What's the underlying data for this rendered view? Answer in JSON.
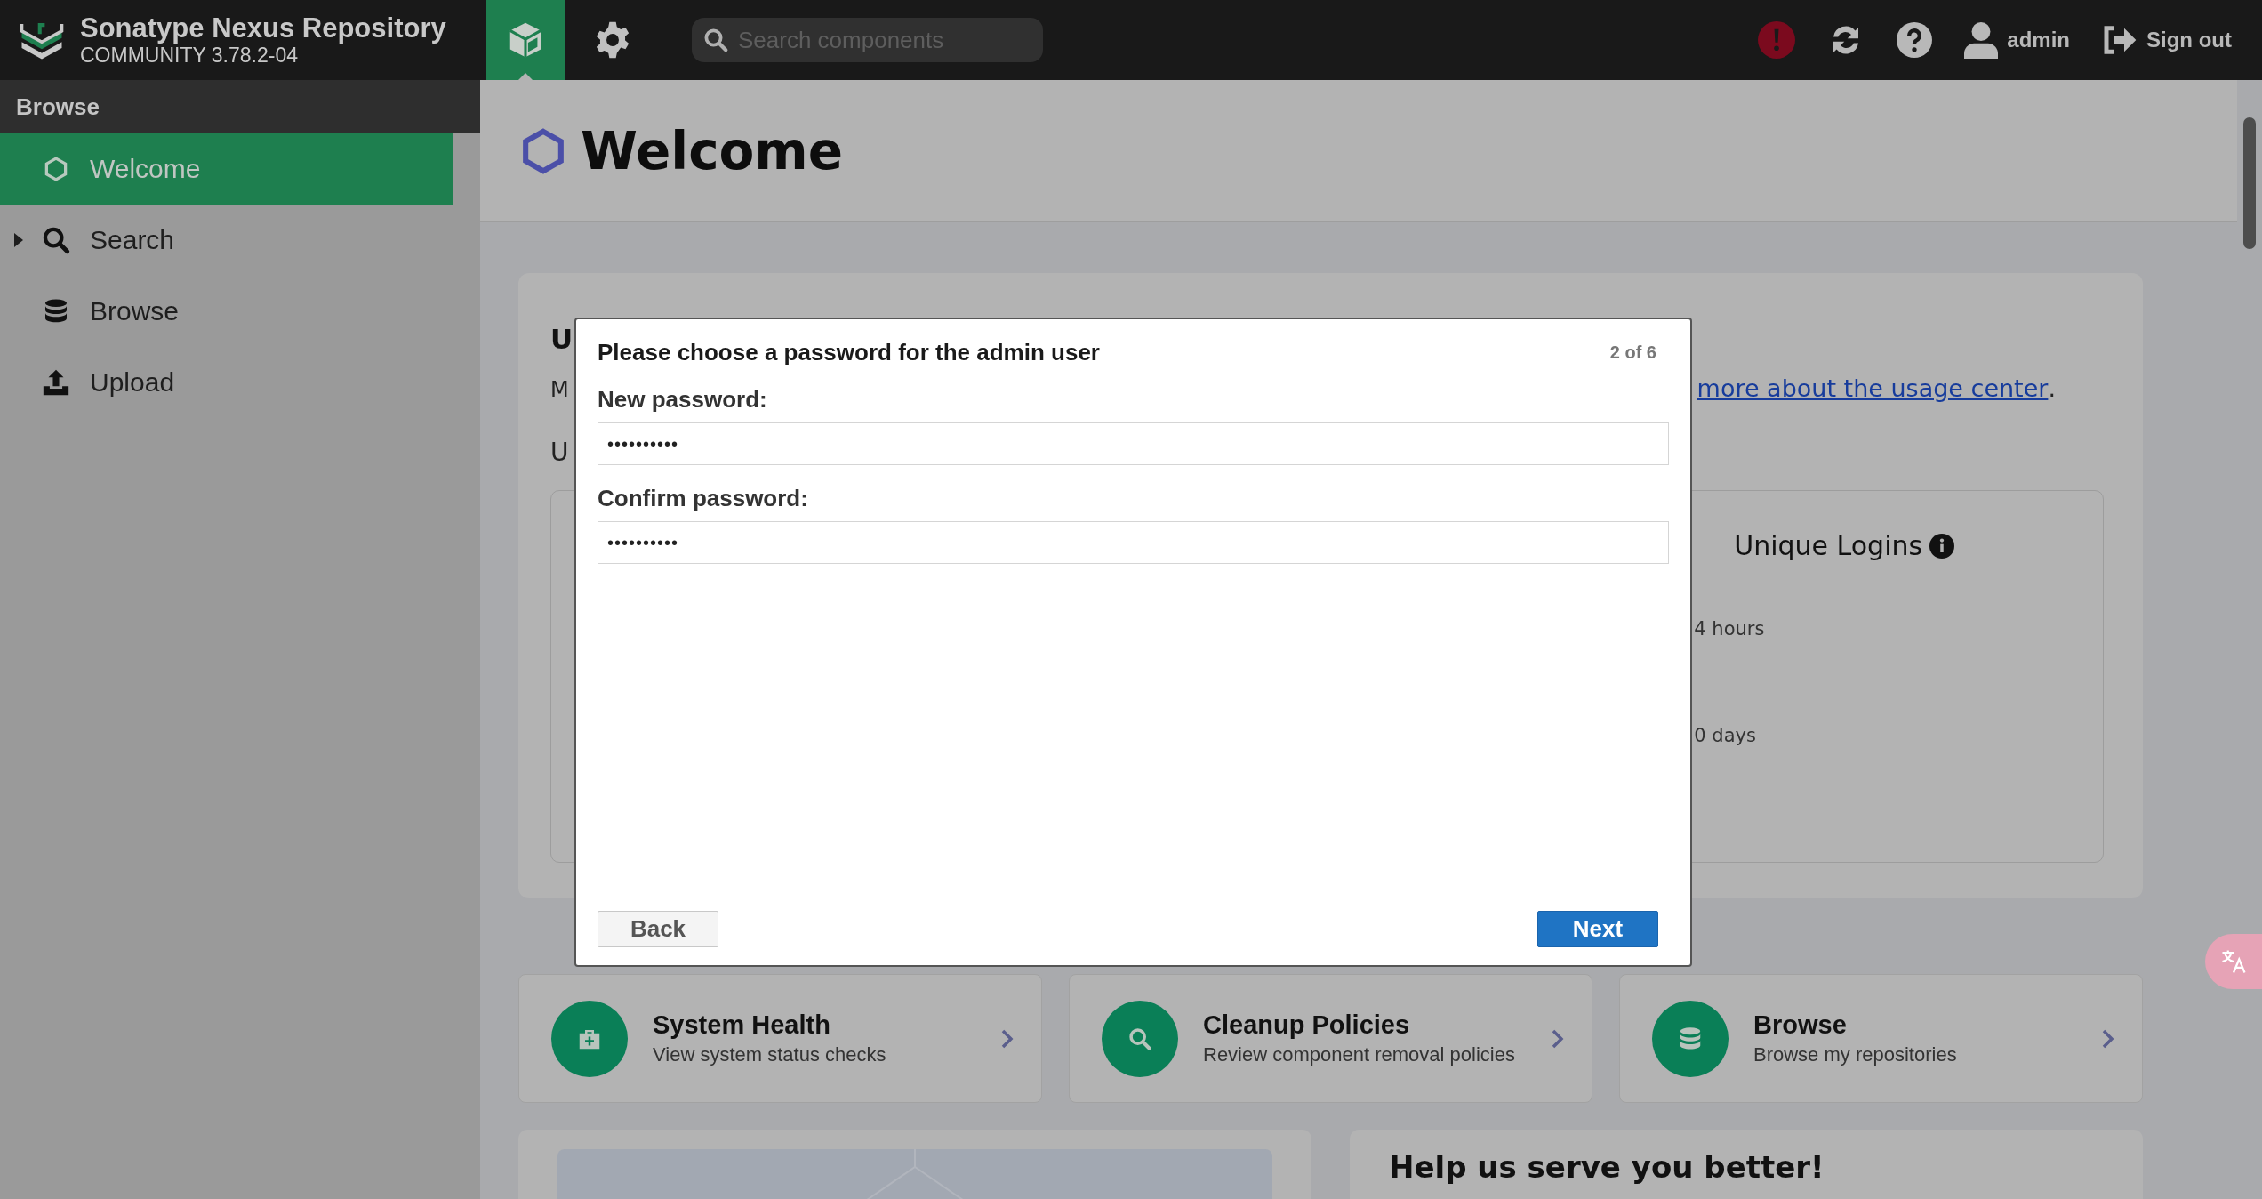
{
  "header": {
    "product_name": "Sonatype Nexus Repository",
    "edition": "COMMUNITY 3.78.2-04",
    "mode_tabs": [
      {
        "kind": "browse",
        "selected": true
      },
      {
        "kind": "admin",
        "selected": false
      }
    ],
    "search": {
      "placeholder": "Search components"
    },
    "user": "admin",
    "sign_out": "Sign out"
  },
  "sidebar": {
    "title": "Browse",
    "items": [
      {
        "label": "Welcome",
        "kind": "welcome",
        "selected": true,
        "expandable": false
      },
      {
        "label": "Search",
        "kind": "search",
        "selected": false,
        "expandable": true
      },
      {
        "label": "Browse",
        "kind": "browse",
        "selected": false,
        "expandable": false
      },
      {
        "label": "Upload",
        "kind": "upload",
        "selected": false,
        "expandable": false
      }
    ]
  },
  "page": {
    "title": "Welcome"
  },
  "usage_card": {
    "title_fragment": "U",
    "text_fragment": "M",
    "link": "more about the usage center",
    "link_suffix": ".",
    "subtitle_fragment": "U",
    "metric_title": "Unique Logins",
    "metric_rows": [
      "4 hours",
      "0 days"
    ]
  },
  "actions": [
    {
      "kind": "health",
      "title": "System Health",
      "subtitle": "View system status checks"
    },
    {
      "kind": "cleanup",
      "title": "Cleanup Policies",
      "subtitle": "Review component removal policies"
    },
    {
      "kind": "browse",
      "title": "Browse",
      "subtitle": "Browse my repositories"
    }
  ],
  "help_card": {
    "title": "Help us serve you better!"
  },
  "dialog": {
    "title": "Please choose a password for the admin user",
    "step": "2 of 6",
    "fields": [
      {
        "label": "New password:",
        "value": "••••••••••"
      },
      {
        "label": "Confirm password:",
        "value": "••••••••••"
      }
    ],
    "buttons": [
      {
        "label": "Back",
        "kind": "secondary"
      },
      {
        "label": "Next",
        "kind": "primary"
      }
    ]
  }
}
